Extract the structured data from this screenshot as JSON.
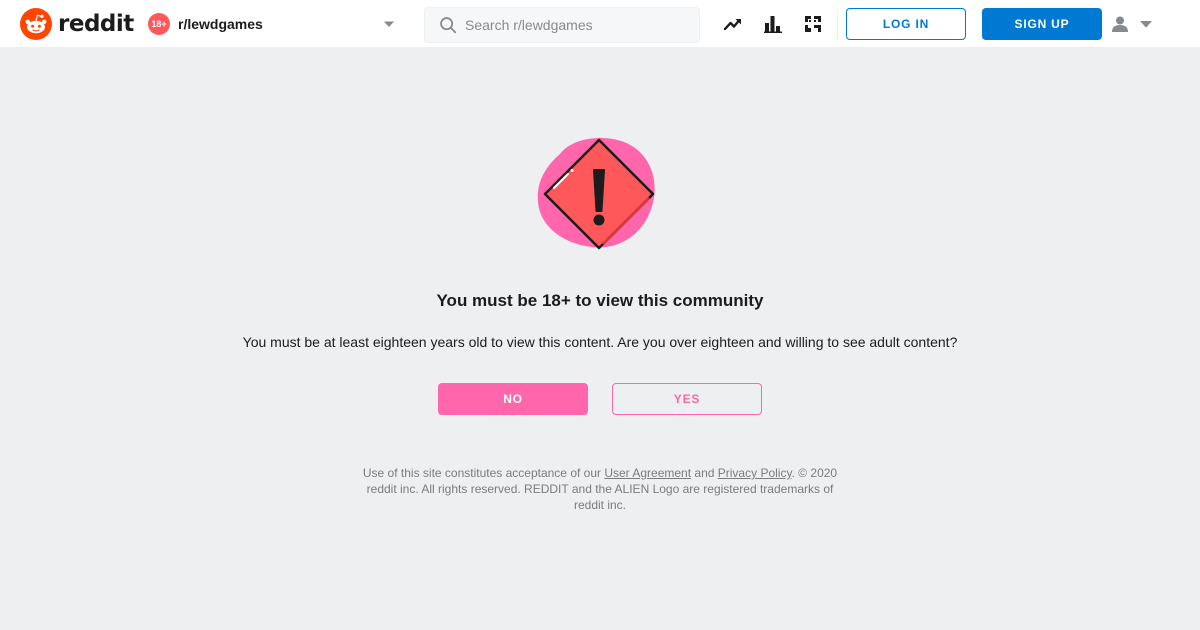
{
  "header": {
    "logo_text": "reddit",
    "community": {
      "badge": "18+",
      "name": "r/lewdgames"
    },
    "search": {
      "placeholder": "Search r/lewdgames"
    },
    "icons": [
      "trending-icon",
      "charts-icon",
      "coins-icon"
    ],
    "login_label": "LOG IN",
    "signup_label": "SIGN UP"
  },
  "gate": {
    "title": "You must be 18+ to view this community",
    "description": "You must be at least eighteen years old to view this content. Are you over eighteen and willing to see adult content?",
    "no_label": "NO",
    "yes_label": "YES"
  },
  "footer": {
    "text_before": "Use of this site constitutes acceptance of our ",
    "user_agreement": "User Agreement",
    "and": " and ",
    "privacy_policy": "Privacy Policy",
    "text_after": ". © 2020 reddit inc. All rights reserved. REDDIT and the ALIEN Logo are registered trademarks of reddit inc."
  },
  "colors": {
    "reddit_orange": "#ff4500",
    "brand_blue": "#0079d3",
    "nsfw_pink": "#ff66ac",
    "warning_red": "#ff585b",
    "background": "#edeff1"
  }
}
